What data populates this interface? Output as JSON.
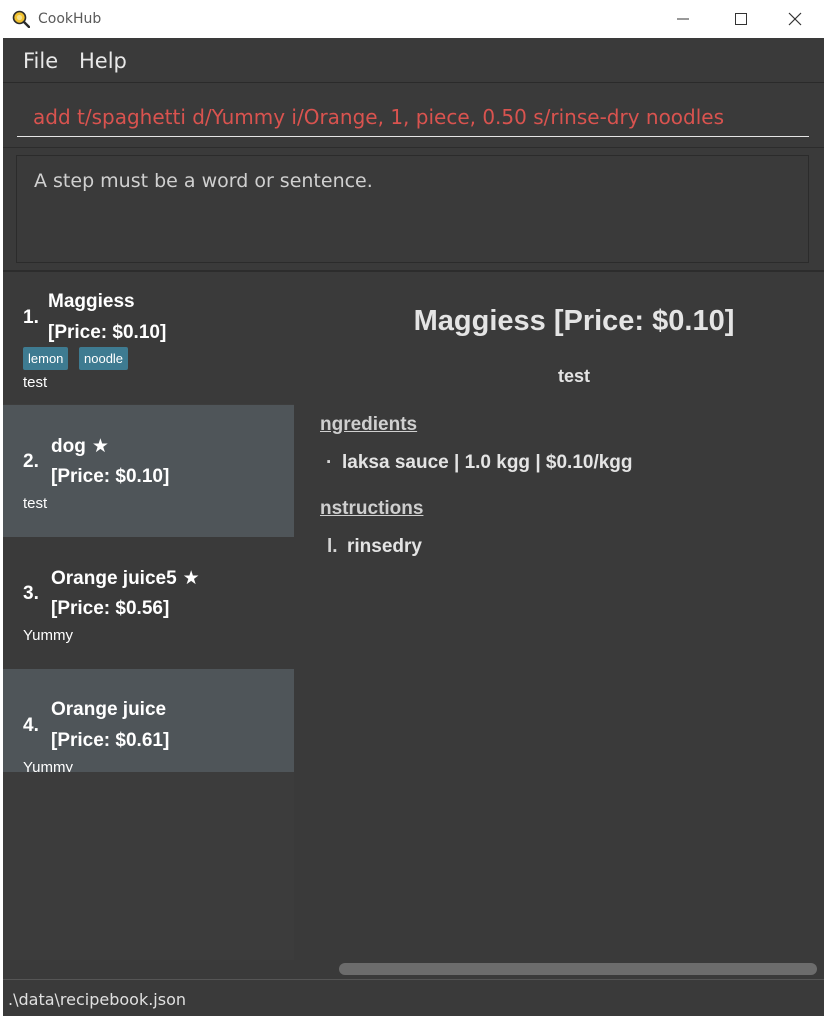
{
  "window": {
    "title": "CookHub"
  },
  "menu": {
    "file": "File",
    "help": "Help"
  },
  "command": {
    "value": "add t/spaghetti d/Yummy i/Orange, 1, piece, 0.50 s/rinse-dry noodles"
  },
  "result": {
    "text": "A step must be a word or sentence."
  },
  "recipes": [
    {
      "index": "1.",
      "name": "Maggiess",
      "starred": false,
      "star": "",
      "price": "[Price: $0.10]",
      "description": "test",
      "tags": [
        "lemon",
        "noodle"
      ]
    },
    {
      "index": "2.",
      "name": "dog",
      "starred": true,
      "star": "★",
      "price": "[Price: $0.10]",
      "description": "test",
      "tags": []
    },
    {
      "index": "3.",
      "name": "Orange juice5",
      "starred": true,
      "star": "★",
      "price": "[Price: $0.56]",
      "description": "Yummy",
      "tags": []
    },
    {
      "index": "4.",
      "name": "Orange juice",
      "starred": false,
      "star": "",
      "price": "[Price: $0.61]",
      "description": "Yummy",
      "tags": []
    }
  ],
  "detail": {
    "title": "Maggiess [Price: $0.10]",
    "description": "test",
    "ingredients_heading": "ngredients",
    "ingredient_bullet": "·",
    "ingredients": [
      "laksa sauce | 1.0 kgg | $0.10/kgg"
    ],
    "instructions_heading": "nstructions",
    "instruction_bullet": "l.",
    "instructions": [
      "rinsedry"
    ]
  },
  "status": {
    "path": ".\\data\\recipebook.json"
  },
  "colors": {
    "background": "#3a3a3a",
    "card_alt": "#4f5559",
    "tag": "#3e7b91",
    "command_text": "#d9534f"
  }
}
